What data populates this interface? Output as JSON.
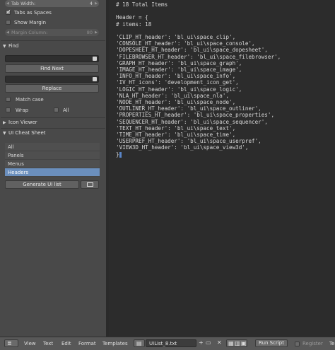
{
  "sidebar": {
    "tab_width": {
      "label": "Tab Width:",
      "value": "4"
    },
    "tabs_as_spaces": {
      "label": "Tabs as Spaces",
      "checked": true
    },
    "show_margin": {
      "label": "Show Margin",
      "checked": false
    },
    "margin_column": {
      "label": "Margin Column:",
      "value": "80"
    },
    "find_panel": {
      "title": "Find",
      "find_next_label": "Find Next",
      "replace_label": "Replace",
      "match_case_label": "Match case",
      "wrap_label": "Wrap",
      "all_label": "All"
    },
    "icon_viewer": {
      "title": "Icon Viewer"
    },
    "ui_cheat_sheet": {
      "title": "UI Cheat Sheet",
      "items": [
        {
          "label": "All",
          "selected": false
        },
        {
          "label": "Panels",
          "selected": false
        },
        {
          "label": "Menus",
          "selected": false
        },
        {
          "label": "Headers",
          "selected": true
        }
      ],
      "generate_label": "Generate UI list"
    }
  },
  "editor": {
    "lines": [
      "# 18 Total Items",
      "",
      "Header = {",
      "# items: 18",
      "",
      "'CLIP_HT_header': 'bl_ui\\space_clip',",
      "'CONSOLE_HT_header': 'bl_ui\\space_console',",
      "'DOPESHEET_HT_header': 'bl_ui\\space_dopesheet',",
      "'FILEBROWSER_HT_header': 'bl_ui\\space_filebrowser',",
      "'GRAPH_HT_header': 'bl_ui\\space_graph',",
      "'IMAGE_HT_header': 'bl_ui\\space_image',",
      "'INFO_HT_header': 'bl_ui\\space_info',",
      "'IV_HT_icons': 'development_icon_get',",
      "'LOGIC_HT_header': 'bl_ui\\space_logic',",
      "'NLA_HT_header': 'bl_ui\\space_nla',",
      "'NODE_HT_header': 'bl_ui\\space_node',",
      "'OUTLINER_HT_header': 'bl_ui\\space_outliner',",
      "'PROPERTIES_HT_header': 'bl_ui\\space_properties',",
      "'SEQUENCER_HT_header': 'bl_ui\\space_sequencer',",
      "'TEXT_HT_header': 'bl_ui\\space_text',",
      "'TIME_HT_header': 'bl_ui\\space_time',",
      "'USERPREF_HT_header': 'bl_ui\\space_userpref',",
      "'VIEW3D_HT_header': 'bl_ui\\space_view3d',",
      "}"
    ]
  },
  "footer": {
    "menus": [
      "View",
      "Text",
      "Edit",
      "Format",
      "Templates"
    ],
    "filename": "UIList_8.txt",
    "run_script_label": "Run Script",
    "register_label": "Register",
    "truncated_label": "Te"
  }
}
